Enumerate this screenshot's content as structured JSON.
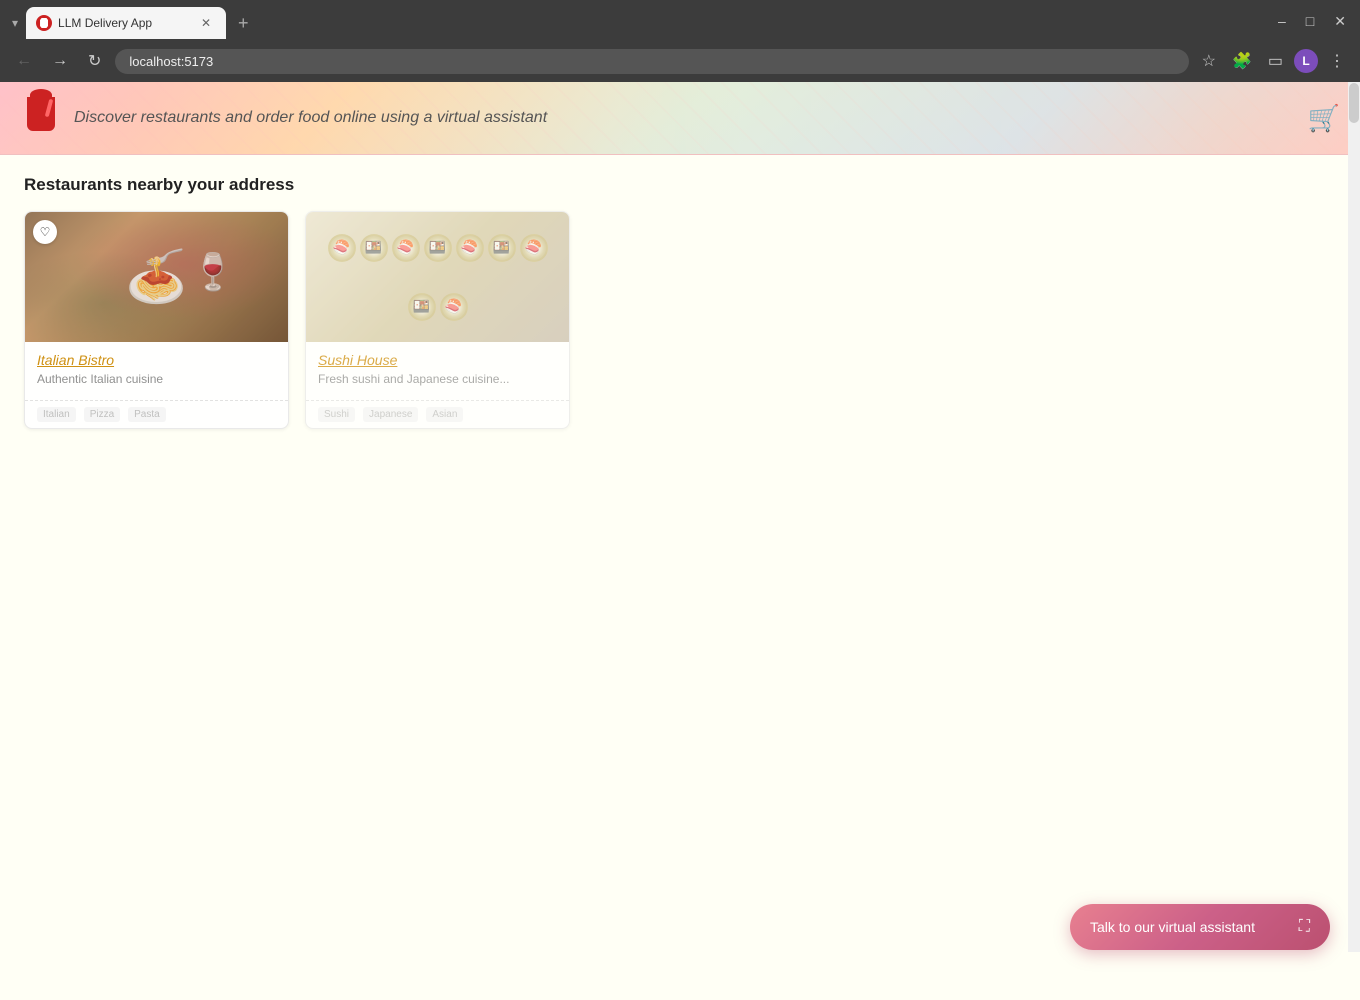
{
  "browser": {
    "tab_title": "LLM Delivery App",
    "new_tab_label": "+",
    "address": "localhost:5173",
    "window_controls": [
      "–",
      "□",
      "×"
    ]
  },
  "header": {
    "tagline": "Discover restaurants and order food online using a virtual assistant",
    "logo_alt": "Delivery App logo"
  },
  "section": {
    "title": "Restaurants nearby your address"
  },
  "restaurants": [
    {
      "name": "Italian Bistro",
      "description": "Authentic Italian cuisine",
      "type": "italian",
      "tags": [
        "Italian",
        "Pizza",
        "Pasta"
      ]
    },
    {
      "name": "Sushi House",
      "description": "Fresh sushi and Japanese cuisine...",
      "type": "sushi",
      "tags": [
        "Sushi",
        "Japanese",
        "Asian"
      ]
    }
  ],
  "va_button": {
    "label": "Talk to our virtual assistant",
    "expand_icon": "⛶"
  },
  "cart_icon": "🛒"
}
